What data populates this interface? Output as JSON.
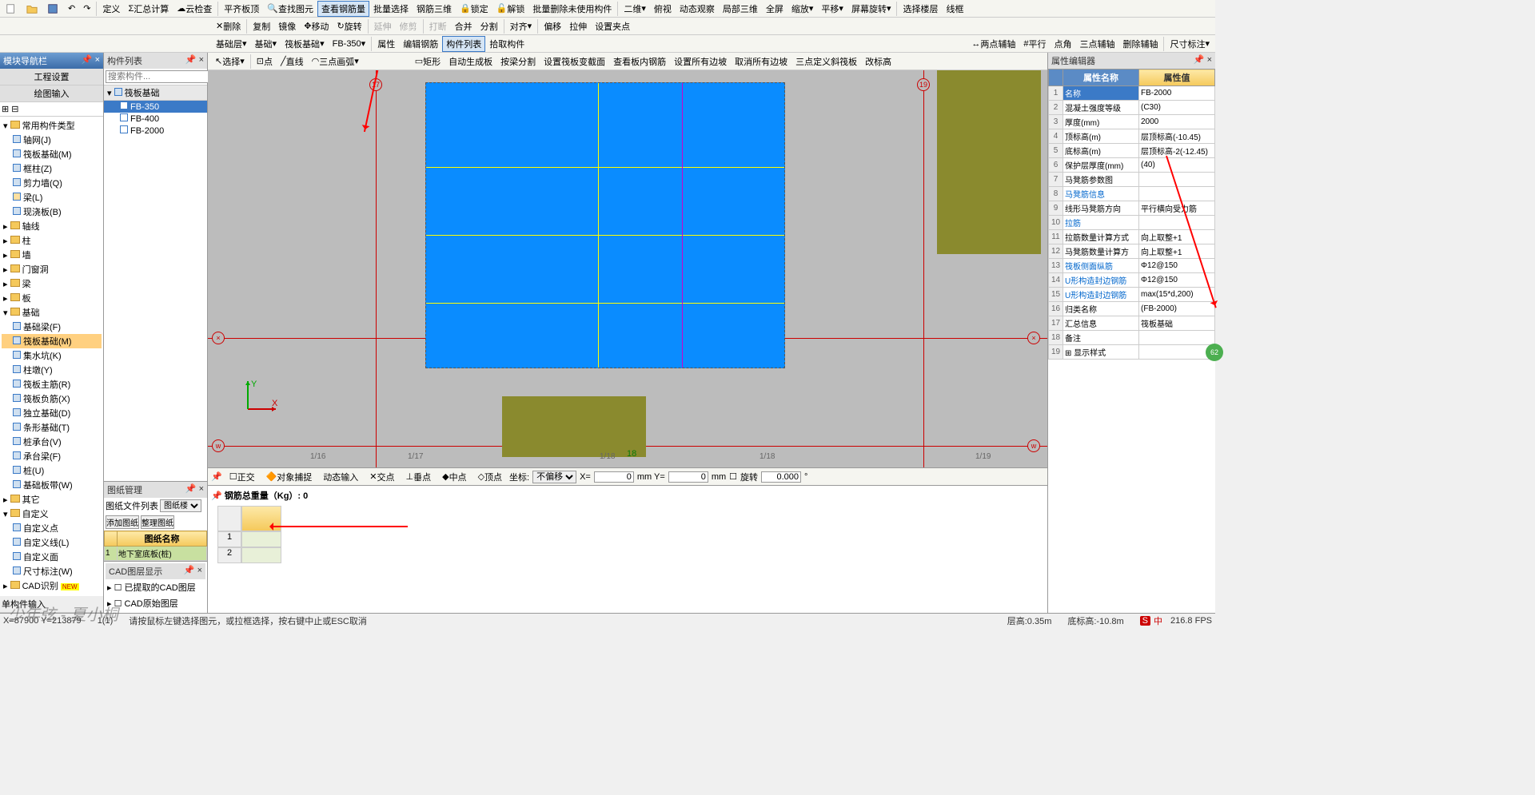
{
  "toolbars": {
    "row1": [
      "定义",
      "汇总计算",
      "云检查",
      "平齐板顶",
      "查找图元",
      "查看钢筋量",
      "批量选择",
      "钢筋三维",
      "锁定",
      "解锁",
      "批量删除未使用构件",
      "二维",
      "俯视",
      "动态观察",
      "局部三维",
      "全屏",
      "缩放",
      "平移",
      "屏幕旋转",
      "选择楼层",
      "线框"
    ],
    "highlight1": "查看钢筋量",
    "row2_left": [
      "删除",
      "复制",
      "镜像",
      "移动",
      "旋转",
      "延伸",
      "修剪",
      "打断",
      "合并",
      "分割",
      "对齐",
      "偏移",
      "拉伸",
      "设置夹点"
    ],
    "row3_left": [
      "基础层",
      "基础",
      "筏板基础",
      "FB-350"
    ],
    "row3_right": [
      "属性",
      "编辑钢筋",
      "构件列表",
      "拾取构件",
      "两点辅轴",
      "平行",
      "点角",
      "三点辅轴",
      "删除辅轴",
      "尺寸标注"
    ],
    "row4_left": [
      "选择",
      "点",
      "直线",
      "三点画弧"
    ],
    "row4_right": [
      "矩形",
      "自动生成板",
      "按梁分割",
      "设置筏板变截面",
      "查看板内钢筋",
      "设置所有边坡",
      "取消所有边坡",
      "三点定义斜筏板",
      "改标高"
    ]
  },
  "nav_panel_title": "模块导航栏",
  "nav_sections": [
    "工程设置",
    "绘图输入"
  ],
  "tree": {
    "root": "常用构件类型",
    "items": [
      "轴网(J)",
      "筏板基础(M)",
      "框柱(Z)",
      "剪力墙(Q)",
      "梁(L)",
      "现浇板(B)"
    ],
    "folders": [
      "轴线",
      "柱",
      "墙",
      "门窗洞",
      "梁",
      "板"
    ],
    "基础_items": [
      "基础梁(F)",
      "筏板基础(M)",
      "集水坑(K)",
      "柱墩(Y)",
      "筏板主筋(R)",
      "筏板负筋(X)",
      "独立基础(D)",
      "条形基础(T)",
      "桩承台(V)",
      "承台梁(F)",
      "桩(U)",
      "基础板带(W)"
    ],
    "基础_selected": "筏板基础(M)",
    "other_folders": [
      "其它",
      "自定义"
    ],
    "自定义_items": [
      "自定义点",
      "自定义线(L)",
      "自定义面",
      "尺寸标注(W)"
    ],
    "last_folder": "CAD识别"
  },
  "基础_label": "基础",
  "complist_panel": "构件列表",
  "search_placeholder": "搜索构件...",
  "complist": {
    "group": "筏板基础",
    "items": [
      "FB-350",
      "FB-400",
      "FB-2000"
    ],
    "selected": "FB-350"
  },
  "drawing_mgr": {
    "title": "图纸管理",
    "tabs": [
      "图纸文件列表",
      "图纸楼"
    ],
    "buttons": [
      "添加图纸",
      "整理图纸"
    ],
    "header": "图纸名称",
    "row1": "地下室底板(桩)"
  },
  "cad_layer": {
    "title": "CAD图层显示",
    "items": [
      "已提取的CAD图层",
      "CAD原始图层"
    ]
  },
  "single_input": "单构件输入",
  "canvas": {
    "grid_v": [
      "1/16",
      "1/17",
      "1/18",
      "1/18",
      "1/19"
    ],
    "axis_v_top": [
      "17",
      "18",
      "19"
    ],
    "axis_h": [
      "w",
      "w",
      "w"
    ],
    "label_18": "18"
  },
  "bottom_toolbar": {
    "opts": [
      "正交",
      "对象捕捉",
      "动态输入",
      "交点",
      "垂点",
      "中点",
      "顶点"
    ],
    "坐标": "坐标:",
    "不偏移": "不偏移",
    "x_label": "X=",
    "y_label": "mm Y=",
    "mm": "mm",
    "旋转": "旋转",
    "rot_val": "0.000",
    "x_val": "0",
    "y_val": "0"
  },
  "rebar": {
    "title": "钢筋总重量（Kg）: 0"
  },
  "prop_panel": "属性编辑器",
  "prop_headers": [
    "属性名称",
    "属性值"
  ],
  "props": [
    {
      "n": "1",
      "name": "名称",
      "val": "FB-2000",
      "sel": true
    },
    {
      "n": "2",
      "name": "混凝土强度等级",
      "val": "(C30)"
    },
    {
      "n": "3",
      "name": "厚度(mm)",
      "val": "2000"
    },
    {
      "n": "4",
      "name": "顶标高(m)",
      "val": "层顶标高(-10.45)"
    },
    {
      "n": "5",
      "name": "底标高(m)",
      "val": "层顶标高-2(-12.45)"
    },
    {
      "n": "6",
      "name": "保护层厚度(mm)",
      "val": "(40)"
    },
    {
      "n": "7",
      "name": "马凳筋参数图",
      "val": ""
    },
    {
      "n": "8",
      "name": "马凳筋信息",
      "val": "",
      "blue": true
    },
    {
      "n": "9",
      "name": "线形马凳筋方向",
      "val": "平行横向受力筋"
    },
    {
      "n": "10",
      "name": "拉筋",
      "val": "",
      "blue": true
    },
    {
      "n": "11",
      "name": "拉筋数量计算方式",
      "val": "向上取整+1"
    },
    {
      "n": "12",
      "name": "马凳筋数量计算方",
      "val": "向上取整+1"
    },
    {
      "n": "13",
      "name": "筏板侧面纵筋",
      "val": "Φ12@150",
      "blue": true
    },
    {
      "n": "14",
      "name": "U形构造封边钢筋",
      "val": "Φ12@150",
      "blue": true
    },
    {
      "n": "15",
      "name": "U形构造封边钢筋",
      "val": "max(15*d,200)",
      "blue": true
    },
    {
      "n": "16",
      "name": "归类名称",
      "val": "(FB-2000)"
    },
    {
      "n": "17",
      "name": "汇总信息",
      "val": "筏板基础"
    },
    {
      "n": "18",
      "name": "备注",
      "val": ""
    },
    {
      "n": "19",
      "name": "显示样式",
      "val": "",
      "exp": true
    }
  ],
  "status": {
    "coords": "X=87900 Y=213879",
    "one": "1(1)",
    "hint": "请按鼠标左键选择图元，或拉框选择，按右键中止或ESC取消",
    "层高": "层高:0.35m",
    "底标高": "底标高:-10.8m",
    "fps": "216.8 FPS"
  },
  "watermark": "少年弦 - 夏小桐",
  "green_bubble": "62"
}
